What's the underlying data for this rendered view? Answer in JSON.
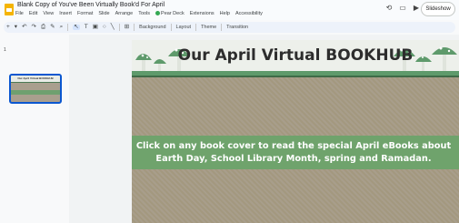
{
  "window": {
    "doc_title": "Blank Copy of You've Been Virtually Book'd  For April",
    "menu": [
      "File",
      "Edit",
      "View",
      "Insert",
      "Format",
      "Slide",
      "Arrange",
      "Tools",
      "Pear Deck",
      "Extensions",
      "Help",
      "Accessibility"
    ],
    "slideshow_label": "Slideshow",
    "top_icons": [
      "history-icon",
      "comment-icon",
      "video-icon"
    ]
  },
  "toolbar": {
    "background": "Background",
    "layout": "Layout",
    "theme": "Theme",
    "transition": "Transition"
  },
  "filmstrip": {
    "slide_number": "1",
    "thumb_title": "Our April Virtual BOOKHUB"
  },
  "slide": {
    "title": "Our April Virtual BOOKHUB",
    "banner_line1": "Click on any book cover to read the special April eBooks about",
    "banner_line2": "Earth Day, School Library Month, spring and Ramadan."
  },
  "colors": {
    "accent": "#0b57d0",
    "banner_green": "#6fa36c",
    "header_bg": "#edf0eb",
    "cardboard": "#a59a87"
  }
}
